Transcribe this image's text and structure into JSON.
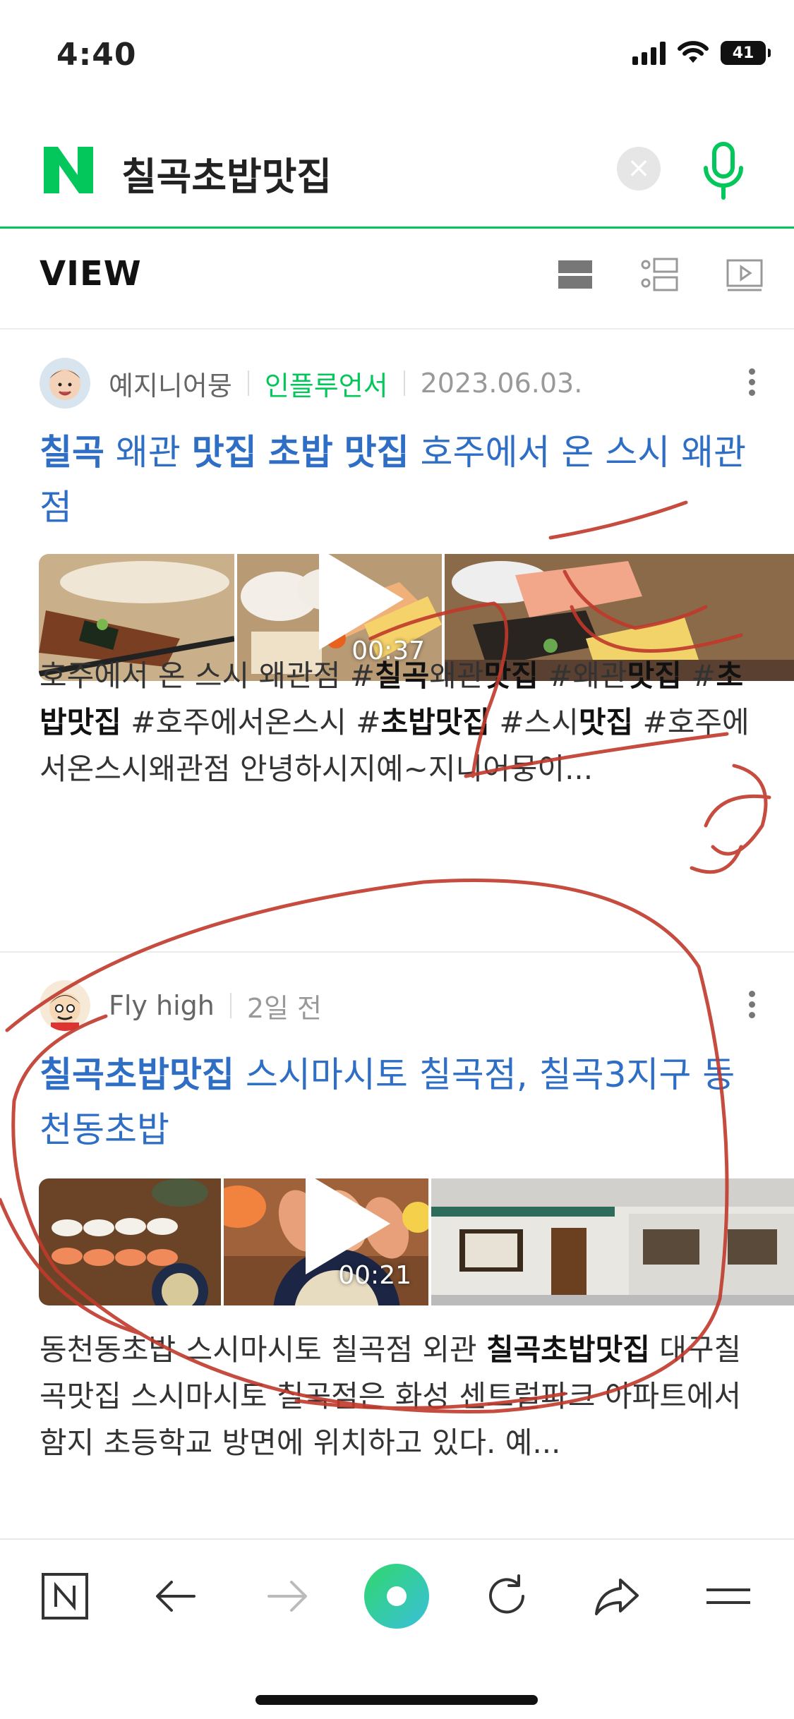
{
  "status": {
    "time": "4:40",
    "battery": "41"
  },
  "search": {
    "query": "칠곡초밥맛집",
    "clear_label": "×"
  },
  "view": {
    "title": "VIEW"
  },
  "posts": [
    {
      "author": "예지니어뭉",
      "badge": "인플루언서",
      "date": "2023.06.03.",
      "title_parts": [
        "칠곡",
        " 왜관 ",
        "맛집",
        " ",
        "초밥",
        " ",
        "맛집",
        " 호주에서 온 스시 왜관점"
      ],
      "video_duration": "00:37",
      "desc_parts": [
        "호주에서 온 스시 왜관점 #",
        "칠곡",
        "왜관",
        "맛집",
        " #왜관",
        "맛집",
        " #",
        "초밥맛집",
        " #호주에서온스시 #",
        "초밥맛집",
        " #스시",
        "맛집",
        " #호주에서온스시왜관점 안녕하시지예~지니어뭉이..."
      ]
    },
    {
      "author": "Fly high",
      "date": "2일 전",
      "title_parts": [
        "칠곡초밥맛집",
        " 스시마시토 칠곡점, 칠곡3지구 동천동초밥"
      ],
      "video_duration": "00:21",
      "desc_parts": [
        "동천동초밥 스시마시토 칠곡점 외관 ",
        "칠곡초밥맛집",
        " 대구칠곡맛집 스시마시토 칠곡점은 화성 센트럴파크 아파트에서 함지 초등학교 방면에 위치하고 있다. 예..."
      ]
    }
  ],
  "toolbar": [
    "naver-home-icon",
    "back-arrow-icon",
    "forward-arrow-icon",
    "green-dot-icon",
    "refresh-icon",
    "share-icon",
    "menu-icon"
  ],
  "colors": {
    "naver_green": "#03c75a",
    "link_blue": "#2f6ec5",
    "scribble_red": "#c0392b"
  }
}
